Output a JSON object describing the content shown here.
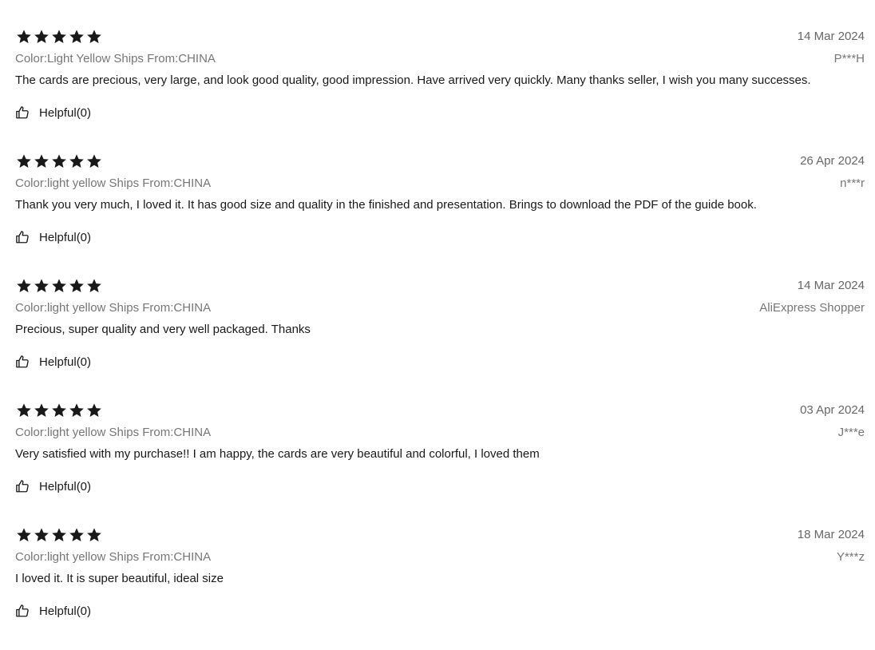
{
  "colors": {
    "star": "#191919",
    "text": "#191919",
    "muted": "#767676"
  },
  "icons": {
    "rating": "star-icon",
    "helpful": "thumbs-up-icon"
  },
  "reviews": [
    {
      "rating": 5,
      "date": "14 Mar 2024",
      "sku": "Color:Light Yellow Ships From:CHINA",
      "user": "P***H",
      "content": "The cards are precious, very large, and look good quality, good impression. Have arrived very quickly. Many thanks seller, I wish you many successes.",
      "helpful_label": "Helpful(0)"
    },
    {
      "rating": 5,
      "date": "26 Apr 2024",
      "sku": "Color:light yellow Ships From:CHINA",
      "user": "n***r",
      "content": "Thank you very much, I loved it. It has good size and quality in the finished and presentation. Brings to download the PDF of the guide book.",
      "helpful_label": "Helpful(0)"
    },
    {
      "rating": 5,
      "date": "14 Mar 2024",
      "sku": "Color:light yellow Ships From:CHINA",
      "user": "AliExpress Shopper",
      "content": "Precious, super quality and very well packaged. Thanks",
      "helpful_label": "Helpful(0)"
    },
    {
      "rating": 5,
      "date": "03 Apr 2024",
      "sku": "Color:light yellow Ships From:CHINA",
      "user": "J***e",
      "content": "Very satisfied with my purchase!! I am happy, the cards are very beautiful and colorful, I loved them",
      "helpful_label": "Helpful(0)"
    },
    {
      "rating": 5,
      "date": "18 Mar 2024",
      "sku": "Color:light yellow Ships From:CHINA",
      "user": "Y***z",
      "content": "I loved it. It is super beautiful, ideal size",
      "helpful_label": "Helpful(0)"
    }
  ]
}
